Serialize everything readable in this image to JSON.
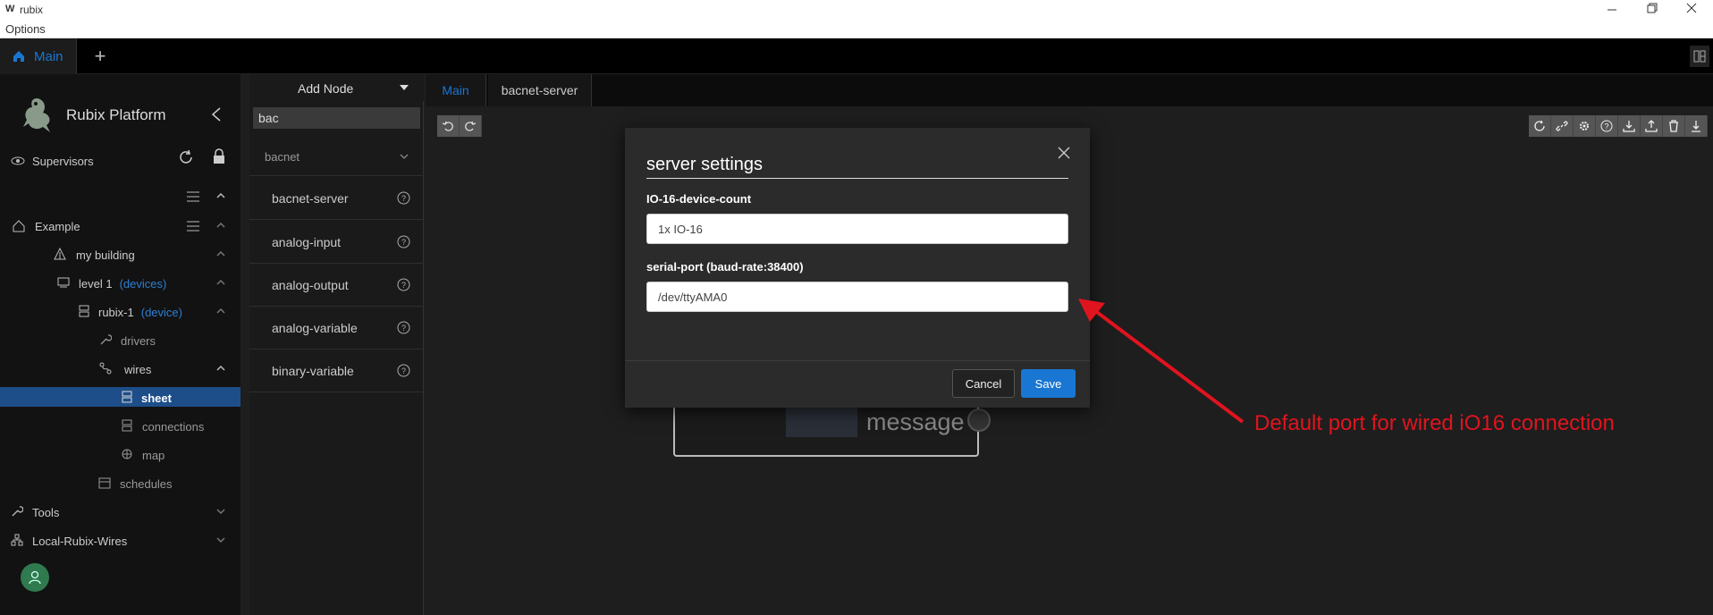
{
  "window": {
    "app_letter": "W",
    "title": "rubix",
    "menu": "Options"
  },
  "tabs": {
    "main_label": "Main"
  },
  "sidebar": {
    "platform_title": "Rubix Platform",
    "items": [
      {
        "label": "Supervisors"
      },
      {
        "label": "Example"
      },
      {
        "label": "my building"
      },
      {
        "label": "level 1",
        "hint": "(devices)"
      },
      {
        "label": "rubix-1",
        "hint": "(device)"
      },
      {
        "label": "drivers"
      },
      {
        "label": "wires"
      },
      {
        "label": "sheet"
      },
      {
        "label": "connections"
      },
      {
        "label": "map"
      },
      {
        "label": "schedules"
      },
      {
        "label": "Tools"
      },
      {
        "label": "Local-Rubix-Wires"
      }
    ]
  },
  "node_panel": {
    "title": "Add Node",
    "search_value": "bac",
    "group": "bacnet",
    "nodes": [
      "bacnet-server",
      "analog-input",
      "analog-output",
      "analog-variable",
      "binary-variable"
    ]
  },
  "editor": {
    "tabs": [
      "Main",
      "bacnet-server"
    ],
    "node_text": "message"
  },
  "dialog": {
    "title": "server settings",
    "field1_label": "IO-16-device-count",
    "field1_value": "1x IO-16",
    "field2_label": "serial-port (baud-rate:38400)",
    "field2_value": "/dev/ttyAMA0",
    "cancel_label": "Cancel",
    "save_label": "Save"
  },
  "annotation": {
    "text": "Default port for wired iO16 connection",
    "color": "#e0141e"
  },
  "colors": {
    "accent": "#1976d2",
    "selected": "#1d4e89"
  }
}
